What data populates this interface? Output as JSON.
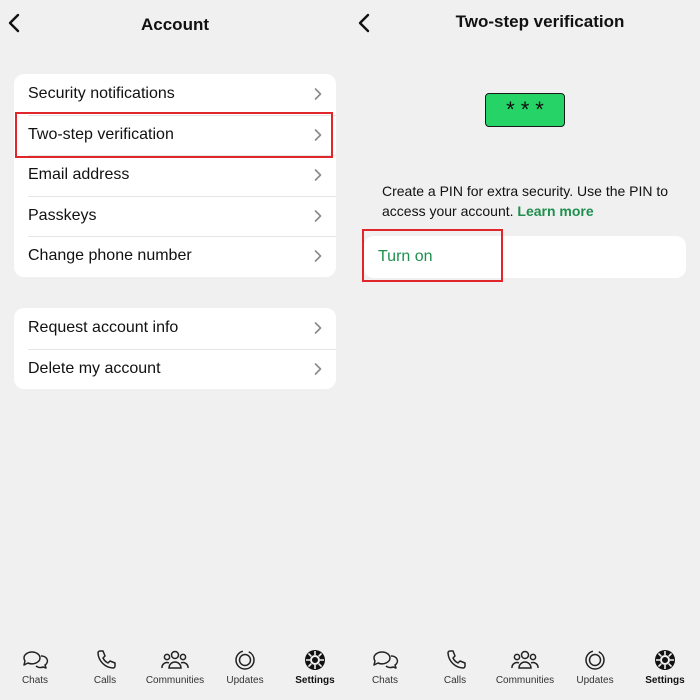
{
  "left": {
    "title": "Account",
    "group1": [
      "Security notifications",
      "Two-step verification",
      "Email address",
      "Passkeys",
      "Change phone number"
    ],
    "group2": [
      "Request account info",
      "Delete my account"
    ]
  },
  "right": {
    "title": "Two-step verification",
    "pin_mask": "***",
    "description": "Create a PIN for extra security. Use the PIN to access your account.",
    "learn_more": "Learn more",
    "turn_on": "Turn on"
  },
  "tabs": [
    {
      "label": "Chats",
      "icon": "chats-icon"
    },
    {
      "label": "Calls",
      "icon": "calls-icon"
    },
    {
      "label": "Communities",
      "icon": "communities-icon"
    },
    {
      "label": "Updates",
      "icon": "updates-icon"
    },
    {
      "label": "Settings",
      "icon": "settings-icon",
      "active": true
    }
  ],
  "colors": {
    "accent": "#1f8f4e",
    "pin_green": "#25d366",
    "highlight": "#e0262a"
  }
}
